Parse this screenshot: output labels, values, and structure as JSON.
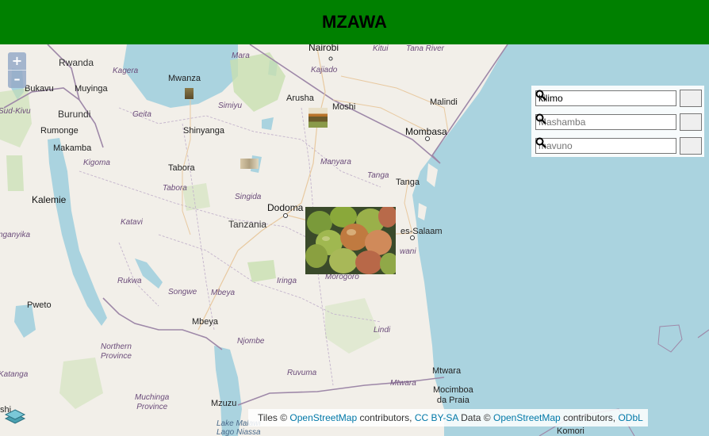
{
  "header": {
    "title": "MZAWA"
  },
  "map": {
    "zoom_in_label": "+",
    "zoom_out_label": "–",
    "water_color": "#aad3df",
    "land_color": "#f2efe9",
    "park_color": "#c8e0b0",
    "border_color": "#9e88a8",
    "countries": [
      {
        "id": "rwanda",
        "label": "Rwanda"
      },
      {
        "id": "burundi",
        "label": "Burundi"
      },
      {
        "id": "tanzania",
        "label": "Tanzania"
      }
    ],
    "cities": [
      {
        "id": "nairobi",
        "label": "Nairobi"
      },
      {
        "id": "mwanza",
        "label": "Mwanza"
      },
      {
        "id": "bukavu",
        "label": "Bukavu"
      },
      {
        "id": "muyinga",
        "label": "Muyinga"
      },
      {
        "id": "shinyanga",
        "label": "Shinyanga"
      },
      {
        "id": "arusha",
        "label": "Arusha"
      },
      {
        "id": "moshi",
        "label": "Moshi"
      },
      {
        "id": "malindi",
        "label": "Malindi"
      },
      {
        "id": "mombasa",
        "label": "Mombasa"
      },
      {
        "id": "rumonge",
        "label": "Rumonge"
      },
      {
        "id": "makamba",
        "label": "Makamba"
      },
      {
        "id": "tabora",
        "label": "Tabora"
      },
      {
        "id": "tanga",
        "label": "Tanga"
      },
      {
        "id": "kalemie",
        "label": "Kalemie"
      },
      {
        "id": "dodoma",
        "label": "Dodoma"
      },
      {
        "id": "dar-es-salaam",
        "label": "es-Salaam"
      },
      {
        "id": "pweto",
        "label": "Pweto"
      },
      {
        "id": "mbeya",
        "label": "Mbeya"
      },
      {
        "id": "mtwara",
        "label": "Mtwara"
      },
      {
        "id": "mocimboa",
        "label": "Mocimboa\nda Praia"
      },
      {
        "id": "mzuzu",
        "label": "Mzuzu"
      },
      {
        "id": "komori",
        "label": "Komori"
      },
      {
        "id": "shi",
        "label": "shi"
      }
    ],
    "regions": [
      {
        "id": "mara",
        "label": "Mara"
      },
      {
        "id": "kitui",
        "label": "Kitui"
      },
      {
        "id": "tana-river",
        "label": "Tana River"
      },
      {
        "id": "kagera",
        "label": "Kagera"
      },
      {
        "id": "kajiado",
        "label": "Kajiado"
      },
      {
        "id": "sud-kivu",
        "label": "Sud-Kivu"
      },
      {
        "id": "geita",
        "label": "Geita"
      },
      {
        "id": "simiyu",
        "label": "Simiyu"
      },
      {
        "id": "kigoma",
        "label": "Kigoma"
      },
      {
        "id": "manyara",
        "label": "Manyara"
      },
      {
        "id": "tanga-region",
        "label": "Tanga"
      },
      {
        "id": "tabora-region",
        "label": "Tabora"
      },
      {
        "id": "singida",
        "label": "Singida"
      },
      {
        "id": "katavi",
        "label": "Katavi"
      },
      {
        "id": "tanganyika",
        "label": "nganyika"
      },
      {
        "id": "rukwa",
        "label": "Rukwa"
      },
      {
        "id": "iringa",
        "label": "Iringa"
      },
      {
        "id": "morogoro",
        "label": "Morogoro"
      },
      {
        "id": "songwe",
        "label": "Songwe"
      },
      {
        "id": "mbeya-region",
        "label": "Mbeya"
      },
      {
        "id": "pwani",
        "label": "wani"
      },
      {
        "id": "lindi",
        "label": "Lindi"
      },
      {
        "id": "njombe",
        "label": "Njombe"
      },
      {
        "id": "northern-province",
        "label": "Northern\nProvince"
      },
      {
        "id": "ruvuma",
        "label": "Ruvuma"
      },
      {
        "id": "mtwara-region",
        "label": "Mtwara"
      },
      {
        "id": "katanga",
        "label": "Katanga"
      },
      {
        "id": "muchinga",
        "label": "Muchinga\nProvince"
      },
      {
        "id": "lake-malawi",
        "label": "Lake Malawi\nLago Niassa"
      }
    ]
  },
  "search": {
    "field1": {
      "value": "kilimo",
      "placeholder": ""
    },
    "field2": {
      "value": "",
      "placeholder": "Mashamba"
    },
    "field3": {
      "value": "",
      "placeholder": "mavuno"
    },
    "button_icon": "search-icon"
  },
  "attribution": {
    "tiles_prefix": "Tiles ©",
    "osm_link": "OpenStreetMap",
    "contributors": "contributors,",
    "cc_link": "CC BY-SA",
    "data_prefix": "Data ©",
    "osm_link2": "OpenStreetMap",
    "contributors2": "contributors,",
    "odbl_link": "ODbL"
  }
}
